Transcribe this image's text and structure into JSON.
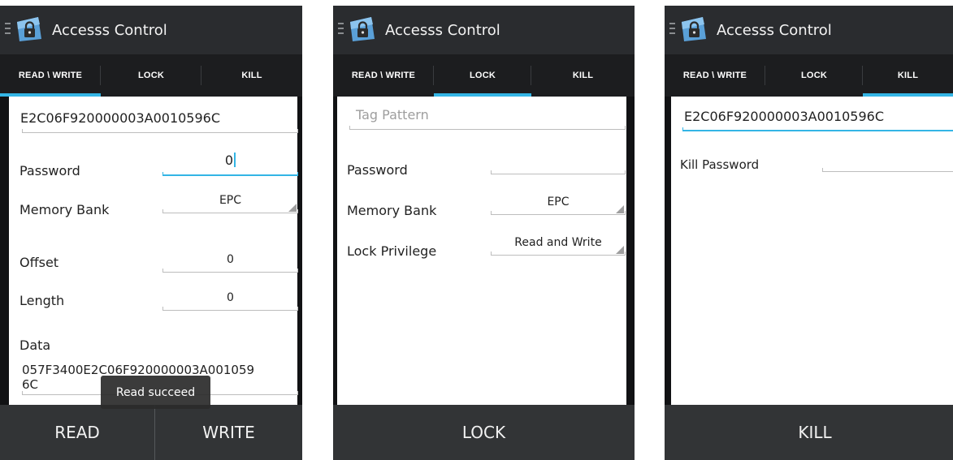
{
  "app": {
    "title": "Accesss Control"
  },
  "tabs": [
    "READ \\ WRITE",
    "LOCK",
    "KILL"
  ],
  "screens": {
    "read_write": {
      "tag_id": "E2C06F920000003A0010596C",
      "password_label": "Password",
      "password_value": "0",
      "memory_bank_label": "Memory Bank",
      "memory_bank_value": "EPC",
      "offset_label": "Offset",
      "offset_value": "0",
      "length_label": "Length",
      "length_value": "0",
      "data_label": "Data",
      "data_line1": "057F3400E2C06F920000003A001059",
      "data_line2": "6C",
      "toast": "Read succeed",
      "read_button": "READ",
      "write_button": "WRITE"
    },
    "lock": {
      "tag_placeholder": "Tag Pattern",
      "password_label": "Password",
      "memory_bank_label": "Memory Bank",
      "memory_bank_value": "EPC",
      "lock_privilege_label": "Lock Privilege",
      "lock_privilege_value": "Read and Write",
      "lock_button": "LOCK"
    },
    "kill": {
      "tag_id": "E2C06F920000003A0010596C",
      "kill_password_label": "Kill Password",
      "kill_button": "KILL"
    }
  },
  "colors": {
    "accent": "#33b5e5",
    "action_bar": "#2a2c2f",
    "tab_bar": "#1c1d1f",
    "bottom_bar": "#323436"
  }
}
